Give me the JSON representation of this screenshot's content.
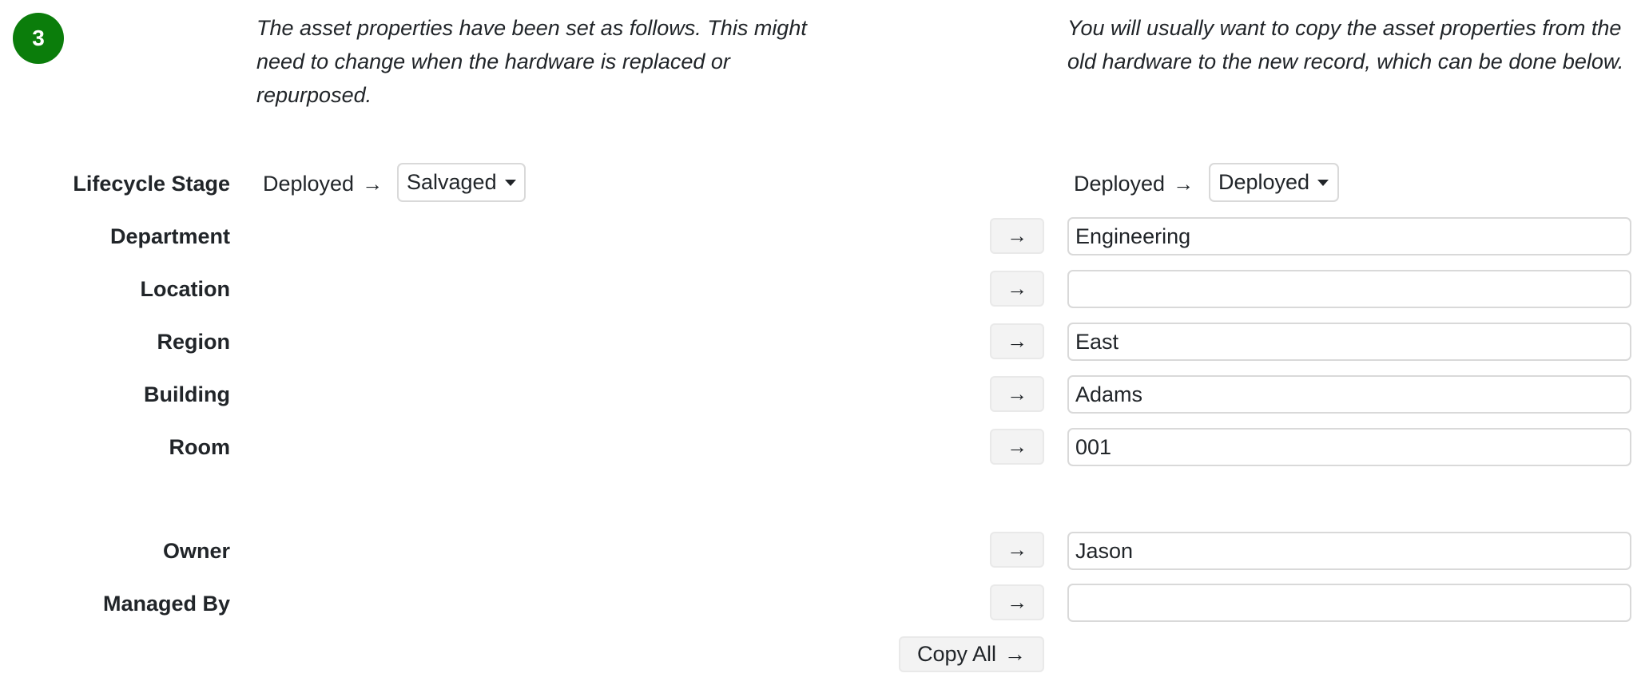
{
  "step": {
    "number": "3",
    "color": "#0b7d0b"
  },
  "intro": {
    "left": "The asset properties have been set as follows. This might need to change when the hardware is replaced or repurposed.",
    "right": "You will usually want to copy the asset properties from the old hardware to the new record, which can be done below."
  },
  "lifecycle": {
    "label": "Lifecycle Stage",
    "old_record": {
      "current": "Deployed",
      "arrow": "→",
      "selected": "Salvaged"
    },
    "new_record": {
      "current": "Deployed",
      "arrow": "→",
      "selected": "Deployed"
    }
  },
  "fields": [
    {
      "label": "Department",
      "value": "Engineering",
      "copy_icon": "→"
    },
    {
      "label": "Location",
      "value": "",
      "copy_icon": "→"
    },
    {
      "label": "Region",
      "value": "East",
      "copy_icon": "→"
    },
    {
      "label": "Building",
      "value": "Adams",
      "copy_icon": "→"
    },
    {
      "label": "Room",
      "value": "001",
      "copy_icon": "→"
    },
    {
      "label": "Owner",
      "value": "Jason",
      "copy_icon": "→"
    },
    {
      "label": "Managed By",
      "value": "",
      "copy_icon": "→"
    }
  ],
  "copy_all": {
    "label": "Copy All",
    "icon": "→"
  }
}
